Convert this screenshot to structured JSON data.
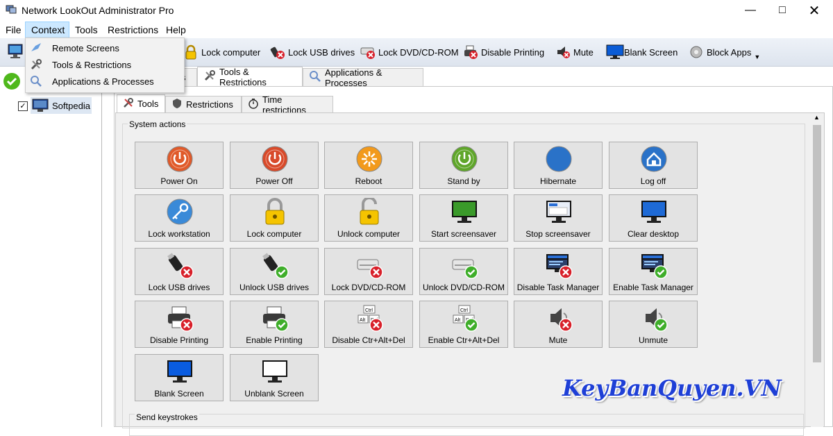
{
  "window": {
    "title": "Network LookOut Administrator Pro"
  },
  "menu": [
    "File",
    "Context",
    "Tools",
    "Restrictions",
    "Help"
  ],
  "context_menu": [
    {
      "label": "Remote Screens",
      "icon": "remote-screens-icon"
    },
    {
      "label": "Tools & Restrictions",
      "icon": "tools-icon"
    },
    {
      "label": "Applications & Processes",
      "icon": "applications-icon"
    }
  ],
  "toolbar": [
    {
      "label": "Lock computer",
      "icon": "padlock-icon"
    },
    {
      "label": "Lock USB drives",
      "icon": "usb-lock-icon"
    },
    {
      "label": "Lock DVD/CD-ROM",
      "icon": "dvd-lock-icon"
    },
    {
      "label": "Disable Printing",
      "icon": "printer-disable-icon"
    },
    {
      "label": "Mute",
      "icon": "mute-icon"
    },
    {
      "label": "Blank Screen",
      "icon": "monitor-icon"
    },
    {
      "label": "Block Apps",
      "icon": "block-apps-icon"
    }
  ],
  "tree": {
    "computer": "Softpedia",
    "checked": true
  },
  "tabs_main": [
    {
      "label": "Tools & Restrictions",
      "active": true
    },
    {
      "label": "Applications & Processes",
      "active": false
    }
  ],
  "tabs_sub": [
    {
      "label": "Tools",
      "active": true
    },
    {
      "label": "Restrictions",
      "active": false
    },
    {
      "label": "Time restrictions",
      "active": false
    }
  ],
  "group_label": "System actions",
  "send_keystrokes_label": "Send keystrokes",
  "actions": [
    [
      {
        "label": "Power On",
        "icon": "power-on-icon"
      },
      {
        "label": "Power Off",
        "icon": "power-off-icon"
      },
      {
        "label": "Reboot",
        "icon": "reboot-icon"
      },
      {
        "label": "Stand by",
        "icon": "standby-icon"
      },
      {
        "label": "Hibernate",
        "icon": "hibernate-icon"
      },
      {
        "label": "Log off",
        "icon": "logoff-icon"
      }
    ],
    [
      {
        "label": "Lock workstation",
        "icon": "key-icon"
      },
      {
        "label": "Lock computer",
        "icon": "padlock-closed-icon"
      },
      {
        "label": "Unlock computer",
        "icon": "padlock-open-icon"
      },
      {
        "label": "Start screensaver",
        "icon": "screensaver-start-icon"
      },
      {
        "label": "Stop screensaver",
        "icon": "screensaver-stop-icon"
      },
      {
        "label": "Clear desktop",
        "icon": "clear-desktop-icon"
      }
    ],
    [
      {
        "label": "Lock USB drives",
        "icon": "usb-lock-icon"
      },
      {
        "label": "Unlock USB drives",
        "icon": "usb-unlock-icon"
      },
      {
        "label": "Lock DVD/CD-ROM",
        "icon": "dvd-lock-icon"
      },
      {
        "label": "Unlock DVD/CD-ROM",
        "icon": "dvd-unlock-icon"
      },
      {
        "label": "Disable Task Manager",
        "icon": "taskmgr-disable-icon"
      },
      {
        "label": "Enable Task Manager",
        "icon": "taskmgr-enable-icon"
      }
    ],
    [
      {
        "label": "Disable Printing",
        "icon": "printer-disable-icon"
      },
      {
        "label": "Enable Printing",
        "icon": "printer-enable-icon"
      },
      {
        "label": "Disable Ctr+Alt+Del",
        "icon": "keys-disable-icon"
      },
      {
        "label": "Enable Ctr+Alt+Del",
        "icon": "keys-enable-icon"
      },
      {
        "label": "Mute",
        "icon": "mute-icon"
      },
      {
        "label": "Unmute",
        "icon": "unmute-icon"
      }
    ],
    [
      {
        "label": "Blank Screen",
        "icon": "monitor-blank-icon"
      },
      {
        "label": "Unblank Screen",
        "icon": "monitor-unblank-icon"
      }
    ]
  ],
  "key_labels": {
    "ctrl": "Ctrl",
    "alt": "Alt",
    "del": "Del"
  },
  "watermark": "KeyBanQuyen.VN",
  "colors": {
    "accent": "#1e3fd6",
    "menu_highlight": "#cce8ff"
  }
}
